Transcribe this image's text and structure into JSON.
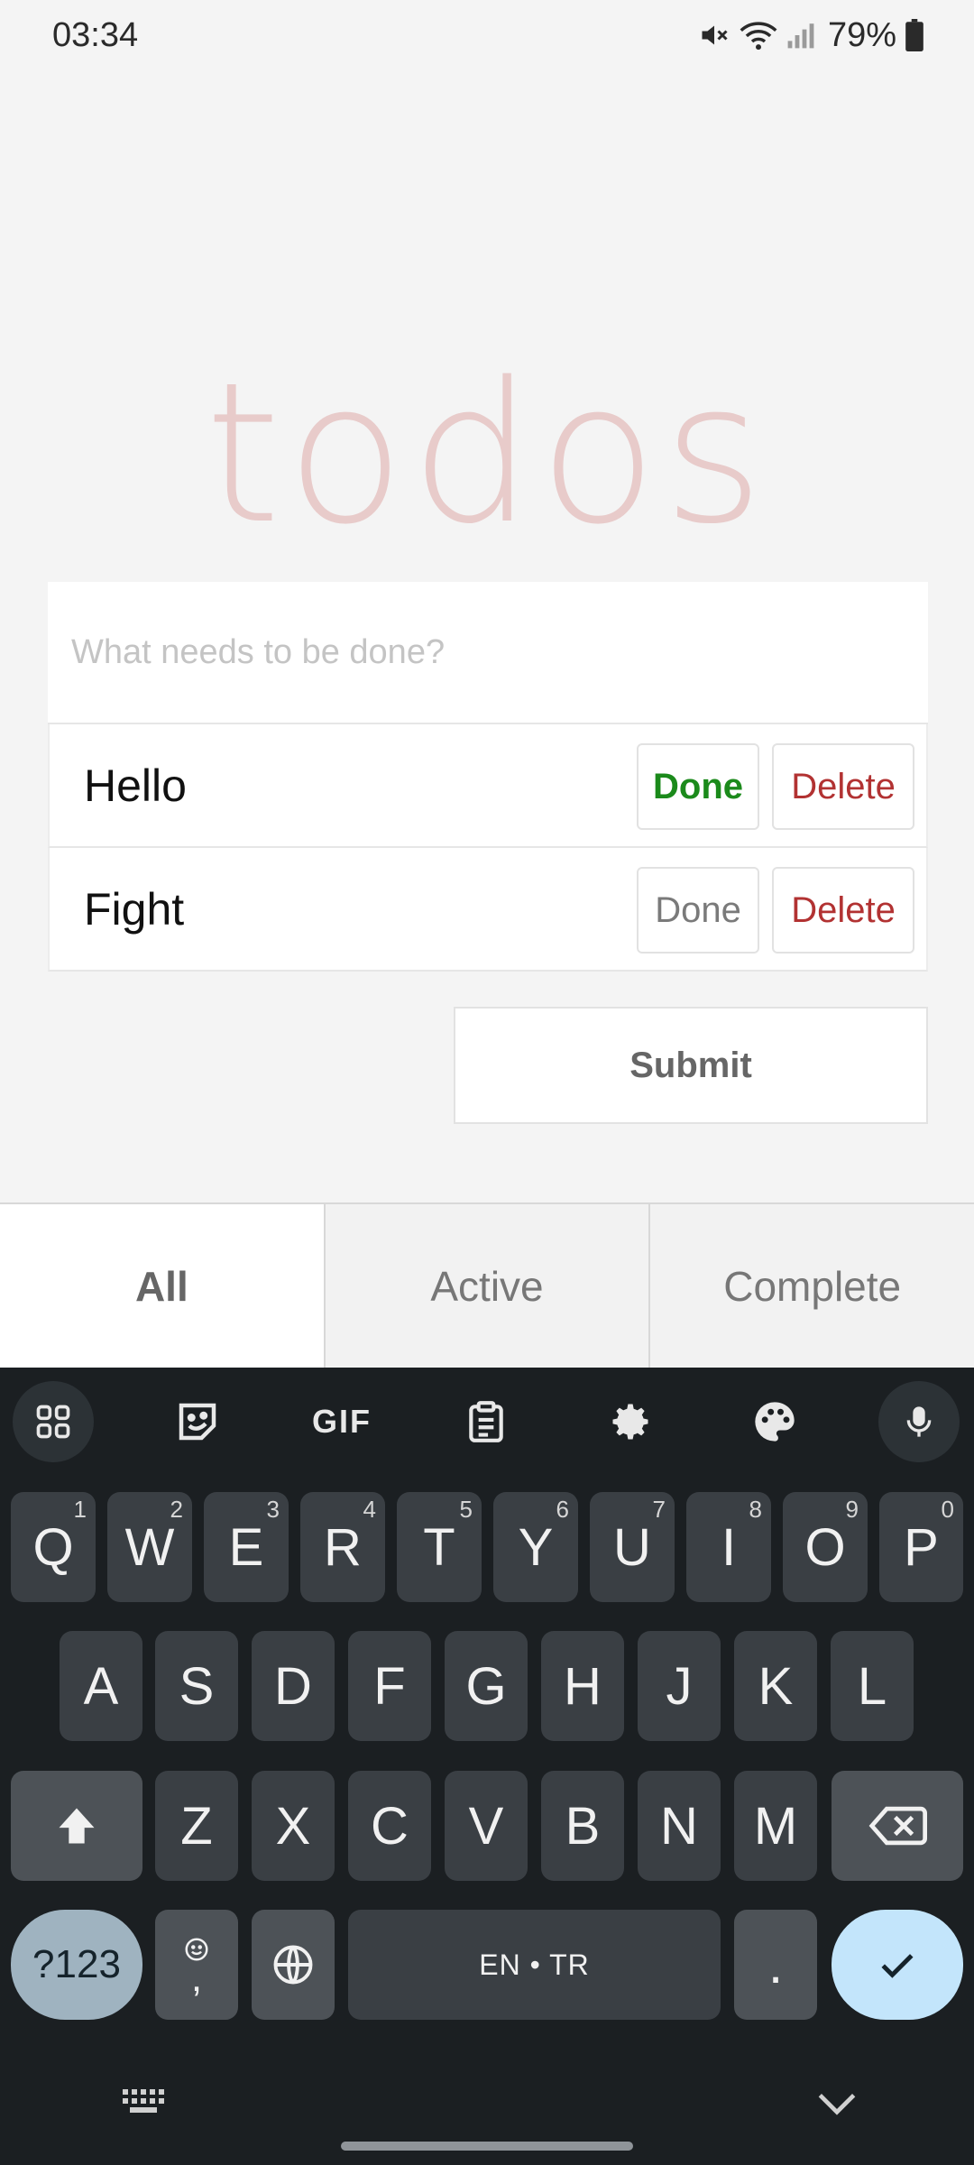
{
  "status_bar": {
    "time": "03:34",
    "battery": "79%",
    "icons": [
      "mute-icon",
      "wifi-icon",
      "signal-icon",
      "battery-icon"
    ]
  },
  "app": {
    "title": "todos",
    "new_todo_placeholder": "What needs to be done?",
    "todos": [
      {
        "label": "Hello",
        "done_label": "Done",
        "delete_label": "Delete",
        "done": true
      },
      {
        "label": "Fight",
        "done_label": "Done",
        "delete_label": "Delete",
        "done": false
      }
    ],
    "submit_label": "Submit",
    "filters": [
      {
        "label": "All",
        "active": true
      },
      {
        "label": "Active",
        "active": false
      },
      {
        "label": "Complete",
        "active": false
      }
    ],
    "colors": {
      "title": "#e8c9c8",
      "done_active": "#1b8a1b",
      "delete": "#b23232"
    }
  },
  "keyboard": {
    "toolbar": [
      "apps-grid-icon",
      "sticker-icon",
      "gif-icon",
      "clipboard-icon",
      "settings-gear-icon",
      "palette-icon",
      "microphone-icon"
    ],
    "gif_label": "GIF",
    "row1": [
      {
        "k": "Q",
        "h": "1"
      },
      {
        "k": "W",
        "h": "2"
      },
      {
        "k": "E",
        "h": "3"
      },
      {
        "k": "R",
        "h": "4"
      },
      {
        "k": "T",
        "h": "5"
      },
      {
        "k": "Y",
        "h": "6"
      },
      {
        "k": "U",
        "h": "7"
      },
      {
        "k": "I",
        "h": "8"
      },
      {
        "k": "O",
        "h": "9"
      },
      {
        "k": "P",
        "h": "0"
      }
    ],
    "row2": [
      "A",
      "S",
      "D",
      "F",
      "G",
      "H",
      "J",
      "K",
      "L"
    ],
    "row3": [
      "Z",
      "X",
      "C",
      "V",
      "B",
      "N",
      "M"
    ],
    "symbols_label": "?123",
    "comma_label": ",",
    "space_label": "EN • TR",
    "period_label": ".",
    "bottom_icons": [
      "keyboard-switch-icon",
      "chevron-down-icon"
    ]
  }
}
